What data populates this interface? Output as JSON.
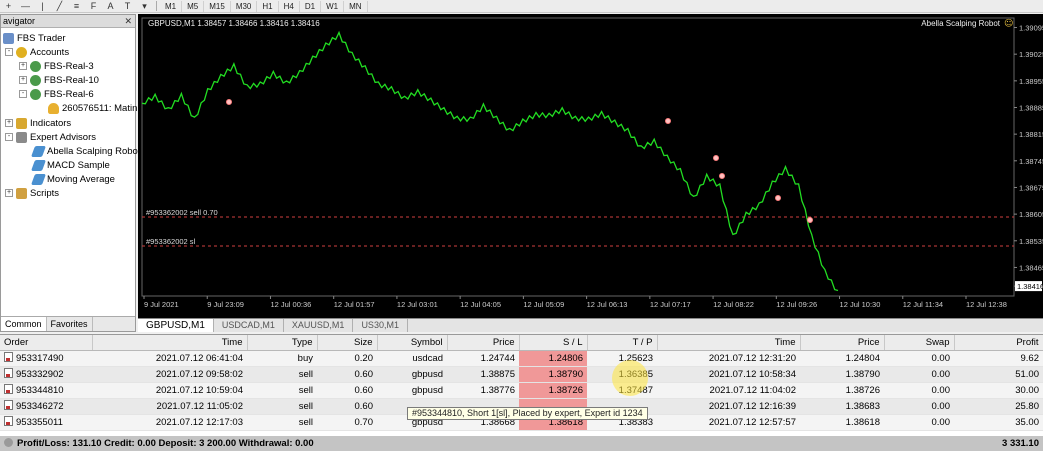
{
  "toolbar": {
    "timeframes": [
      "M1",
      "M5",
      "M15",
      "M30",
      "H1",
      "H4",
      "D1",
      "W1",
      "MN"
    ],
    "icons": [
      "crosshair-icon",
      "hline-icon",
      "vline-icon",
      "trendline-icon",
      "channel-icon",
      "fibonacci-icon",
      "text-icon",
      "label-icon",
      "shapes-icon"
    ]
  },
  "navigator": {
    "title": "avigator",
    "close_glyph": "✕",
    "tree": [
      {
        "label": "FBS Trader",
        "toggle": "",
        "icon": "computer-icon",
        "level": 0
      },
      {
        "label": "Accounts",
        "toggle": "-",
        "icon": "accounts-icon",
        "level": 1
      },
      {
        "label": "FBS-Real-3",
        "toggle": "+",
        "icon": "server-icon",
        "level": 2
      },
      {
        "label": "FBS-Real-10",
        "toggle": "+",
        "icon": "server-icon",
        "level": 2
      },
      {
        "label": "FBS-Real-6",
        "toggle": "-",
        "icon": "server-icon",
        "level": 2
      },
      {
        "label": "260576511: Matin",
        "toggle": "",
        "icon": "user-icon",
        "level": 3
      },
      {
        "label": "Indicators",
        "toggle": "+",
        "icon": "indicators-icon",
        "level": 0
      },
      {
        "label": "Expert Advisors",
        "toggle": "-",
        "icon": "expert-advisors-icon",
        "level": 0
      },
      {
        "label": "Abella Scalping Robo",
        "toggle": "",
        "icon": "ea-icon",
        "level": 1
      },
      {
        "label": "MACD Sample",
        "toggle": "",
        "icon": "ea-icon",
        "level": 1
      },
      {
        "label": "Moving Average",
        "toggle": "",
        "icon": "ea-icon",
        "level": 1
      },
      {
        "label": "Scripts",
        "toggle": "+",
        "icon": "scripts-icon",
        "level": 0
      }
    ],
    "tabs": [
      "Common",
      "Favorites"
    ]
  },
  "chart": {
    "header": "GBPUSD,M1  1.38457 1.38466 1.38416 1.38416",
    "ea_name": "Abella Scalping Robot",
    "order_labels": [
      "#953362002 sell 0.70",
      "#953362002 sl"
    ],
    "current_price": "1.38416",
    "bg_color": "#000000",
    "line_color": "#22dd22",
    "order_line_color": "#d04040"
  },
  "chart_data": {
    "type": "line",
    "x_labels": [
      "9 Jul 2021",
      "9 Jul 23:09",
      "12 Jul 00:36",
      "12 Jul 01:57",
      "12 Jul 03:01",
      "12 Jul 04:05",
      "12 Jul 05:09",
      "12 Jul 06:13",
      "12 Jul 07:17",
      "12 Jul 08:22",
      "12 Jul 09:26",
      "12 Jul 10:30",
      "12 Jul 11:34",
      "12 Jul 12:38"
    ],
    "y_ticks": [
      1.38416,
      1.38465,
      1.38535,
      1.38605,
      1.38675,
      1.38745,
      1.38815,
      1.38885,
      1.38955,
      1.39025,
      1.39095
    ],
    "ylim": [
      1.3839,
      1.3912
    ],
    "series": [
      {
        "values": [
          1.389,
          1.3891,
          1.3888,
          1.3892,
          1.3885,
          1.3893,
          1.3897,
          1.3899,
          1.3894,
          1.3895,
          1.3897,
          1.3895,
          1.3898,
          1.3901,
          1.3905,
          1.3908,
          1.3902,
          1.3899,
          1.3895,
          1.3893,
          1.3891,
          1.3893,
          1.389,
          1.3888,
          1.3886,
          1.3885,
          1.3889,
          1.3886,
          1.3882,
          1.3885,
          1.3887,
          1.3886,
          1.3888,
          1.3886,
          1.3885,
          1.3887,
          1.3885,
          1.3882,
          1.3878,
          1.388,
          1.3875,
          1.3872,
          1.3865,
          1.387,
          1.3868,
          1.3855,
          1.386,
          1.3863,
          1.3869,
          1.3872,
          1.3868,
          1.3855,
          1.3845,
          1.384
        ]
      }
    ]
  },
  "chart_tabs": [
    "GBPUSD,M1",
    "USDCAD,M1",
    "XAUUSD,M1",
    "US30,M1"
  ],
  "terminal": {
    "columns": [
      "Order",
      "Time",
      "Type",
      "Size",
      "Symbol",
      "Price",
      "S / L",
      "T / P",
      "Time",
      "Price",
      "Swap",
      "Profit"
    ],
    "rows": [
      [
        "953317490",
        "2021.07.12 06:41:04",
        "buy",
        "0.20",
        "usdcad",
        "1.24744",
        "1.24806",
        "1.25623",
        "2021.07.12 12:31:20",
        "1.24804",
        "0.00",
        "9.62"
      ],
      [
        "953332902",
        "2021.07.12 09:58:02",
        "sell",
        "0.60",
        "gbpusd",
        "1.38875",
        "1.38790",
        "1.36385",
        "2021.07.12 10:58:34",
        "1.38790",
        "0.00",
        "51.00"
      ],
      [
        "953344810",
        "2021.07.12 10:59:04",
        "sell",
        "0.60",
        "gbpusd",
        "1.38776",
        "1.38726",
        "1.37487",
        "2021.07.12 11:04:02",
        "1.38726",
        "0.00",
        "30.00"
      ],
      [
        "953346272",
        "2021.07.12 11:05:02",
        "sell",
        "0.60",
        "",
        "",
        "",
        "",
        "2021.07.12 12:16:39",
        "1.38683",
        "0.00",
        "25.80"
      ],
      [
        "953355011",
        "2021.07.12 12:17:03",
        "sell",
        "0.70",
        "gbpusd",
        "1.38668",
        "1.38618",
        "1.38383",
        "2021.07.12 12:57:57",
        "1.38618",
        "0.00",
        "35.00"
      ]
    ],
    "tooltip": "#953344810, Short 1[sl], Placed by expert, Expert id 1234",
    "summary_left": "Profit/Loss: 131.10  Credit: 0.00  Deposit: 3 200.00  Withdrawal: 0.00",
    "summary_right": "3 331.10",
    "sl_color": "#f09898"
  }
}
